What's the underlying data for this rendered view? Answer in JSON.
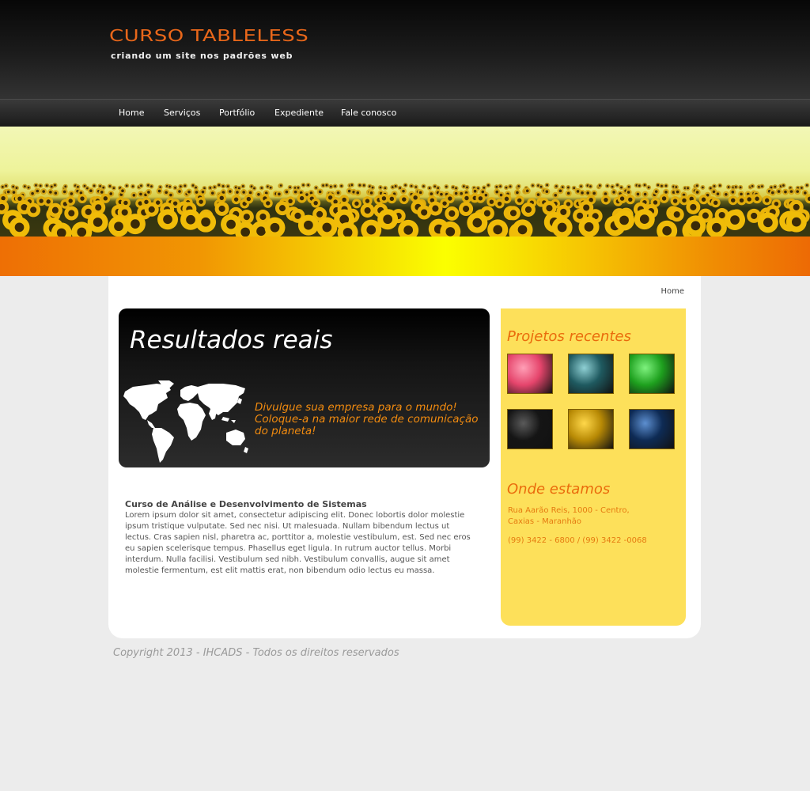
{
  "header": {
    "logo_title": "Curso Tableless",
    "logo_subtitle": "criando um site nos padrões web"
  },
  "nav": {
    "items": [
      {
        "label": "Home"
      },
      {
        "label": "Serviços"
      },
      {
        "label": "Portfólio"
      },
      {
        "label": "Expediente"
      },
      {
        "label": "Fale conosco"
      }
    ]
  },
  "breadcrumb": "Home",
  "feature": {
    "title": "Resultados reais",
    "text": "Divulgue sua empresa para o mundo! Coloque-a na maior rede de comunicação do planeta!"
  },
  "article": {
    "title": "Curso de Análise e Desenvolvimento de Sistemas",
    "body": "Lorem ipsum dolor sit amet, consectetur adipiscing elit. Donec lobortis dolor molestie ipsum tristique vulputate. Sed nec nisi. Ut malesuada. Nullam bibendum lectus ut lectus. Cras sapien nisl, pharetra ac, porttitor a, molestie vestibulum, est. Sed nec eros eu sapien scelerisque tempus. Phasellus eget ligula. In rutrum auctor tellus. Morbi interdum. Nulla facilisi. Vestibulum sed nibh. Vestibulum convallis, augue sit amet molestie fermentum, est elit mattis erat, non bibendum odio lectus eu massa."
  },
  "sidebar": {
    "projects_heading": "Projetos recentes",
    "thumbnails": [
      {
        "color": "#e5456c",
        "accent": "#ff9fb6"
      },
      {
        "color": "#1f5a60",
        "accent": "#8fd0d4"
      },
      {
        "color": "#1ea01e",
        "accent": "#7ef27e"
      },
      {
        "color": "#151515",
        "accent": "#5a5a5a"
      },
      {
        "color": "#b88a05",
        "accent": "#ffd84a"
      },
      {
        "color": "#0e2b55",
        "accent": "#5d8fd0"
      }
    ],
    "location_heading": "Onde estamos",
    "address_line1": "Rua Aarão Reis, 1000 - Centro,",
    "address_line2": "Caxias - Maranhão",
    "phone": "(99) 3422 - 6800 / (99) 3422 -0068"
  },
  "footer": {
    "copyright": "Copyright 2013 - IHCADS - Todos os direitos reservados"
  },
  "colors": {
    "accent_orange": "#ea6b0c",
    "sidebar_yellow": "#fde05a",
    "page_background": "#ececec"
  }
}
